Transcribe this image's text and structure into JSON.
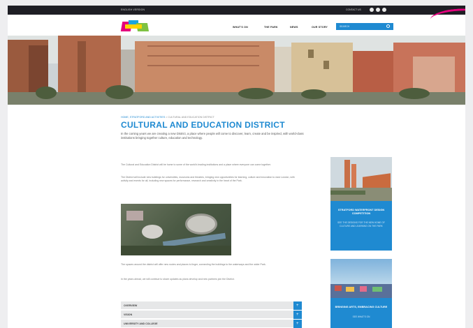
{
  "topbar": {
    "left_text": "ENGLISH VERSION",
    "right_text": "CONTACT US"
  },
  "nav": {
    "items": [
      "WHAT'S ON",
      "THE PARK",
      "NEWS",
      "OUR STORY"
    ]
  },
  "search": {
    "placeholder": "SEARCH"
  },
  "breadcrumb": {
    "home": "HOME, STRATFORD AND ACTIVITIES",
    "current": "CULTURAL AND EDUCATION DISTRICT"
  },
  "page_title": "CULTURAL AND EDUCATION DISTRICT",
  "intro": "In the coming years we are creating a new District, a place where people will come to discover, learn, create and be inspired, with world-class institutions bringing together culture, education and technology.",
  "paragraphs": [
    "The Cultural and Education District will be home to some of the world's leading institutions and a place where everyone can come together.",
    "The District will include new buildings for universities, museums and theatres, bringing new opportunities for learning, culture and innovation to east London, with activity and events for all, including new spaces for performance, research and creativity in the heart of the Park.",
    "The spaces around the district will offer new routes and places to linger, connecting the buildings to the waterways and the wider Park.",
    "In the years ahead, we will continue to share updates as plans develop and new partners join the District."
  ],
  "accordion": [
    {
      "label": "OVERVIEW"
    },
    {
      "label": "VISION"
    },
    {
      "label": "UNIVERSITY AND COLLEGE"
    }
  ],
  "cards": [
    {
      "title": "STRATFORD WATERFRONT DESIGN COMPETITION",
      "subtitle": "SEE THE DESIGNS FOR THE NEW HOME OF CULTURE AND LEARNING ON THE PARK"
    },
    {
      "title": "BRINGING ARTS, EMBRACING CULTURE",
      "subtitle": "SEE WHAT'S ON"
    }
  ],
  "colors": {
    "accent": "#1f8ad1",
    "brand_pink": "#e4007d",
    "topbar": "#1e1e24"
  },
  "icons": [
    "facebook-icon",
    "twitter-icon",
    "instagram-icon",
    "search-icon",
    "plus-icon"
  ]
}
